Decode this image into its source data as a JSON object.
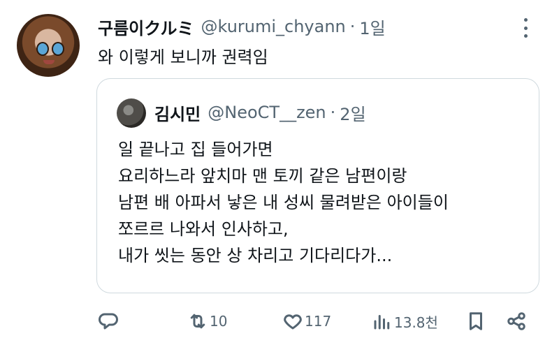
{
  "author": {
    "display_name": "구름이クルミ",
    "handle": "@kurumi_chyann",
    "separator": "·",
    "time": "1일"
  },
  "tweet_text": "와 이렇게 보니까 권력임",
  "quoted": {
    "display_name": "김시민",
    "handle": "@NeoCT__zen",
    "separator": "·",
    "time": "2일",
    "lines": [
      "일 끝나고 집 들어가면",
      "요리하느라 앞치마 맨 토끼 같은 남편이랑",
      "남편 배 아파서 낳은 내 성씨 물려받은 아이들이",
      "쪼르르 나와서 인사하고,",
      "내가 씻는 동안 상 차리고 기다리다가..."
    ]
  },
  "actions": {
    "reply": {
      "icon": "reply-icon",
      "count": ""
    },
    "retweet": {
      "icon": "retweet-icon",
      "count": "10"
    },
    "like": {
      "icon": "heart-icon",
      "count": "117"
    },
    "views": {
      "icon": "views-icon",
      "count": "13.8천"
    },
    "bookmark": {
      "icon": "bookmark-icon"
    },
    "share": {
      "icon": "share-icon"
    }
  },
  "colors": {
    "text": "#0f1419",
    "secondary": "#536471",
    "border": "#cfd9de"
  }
}
